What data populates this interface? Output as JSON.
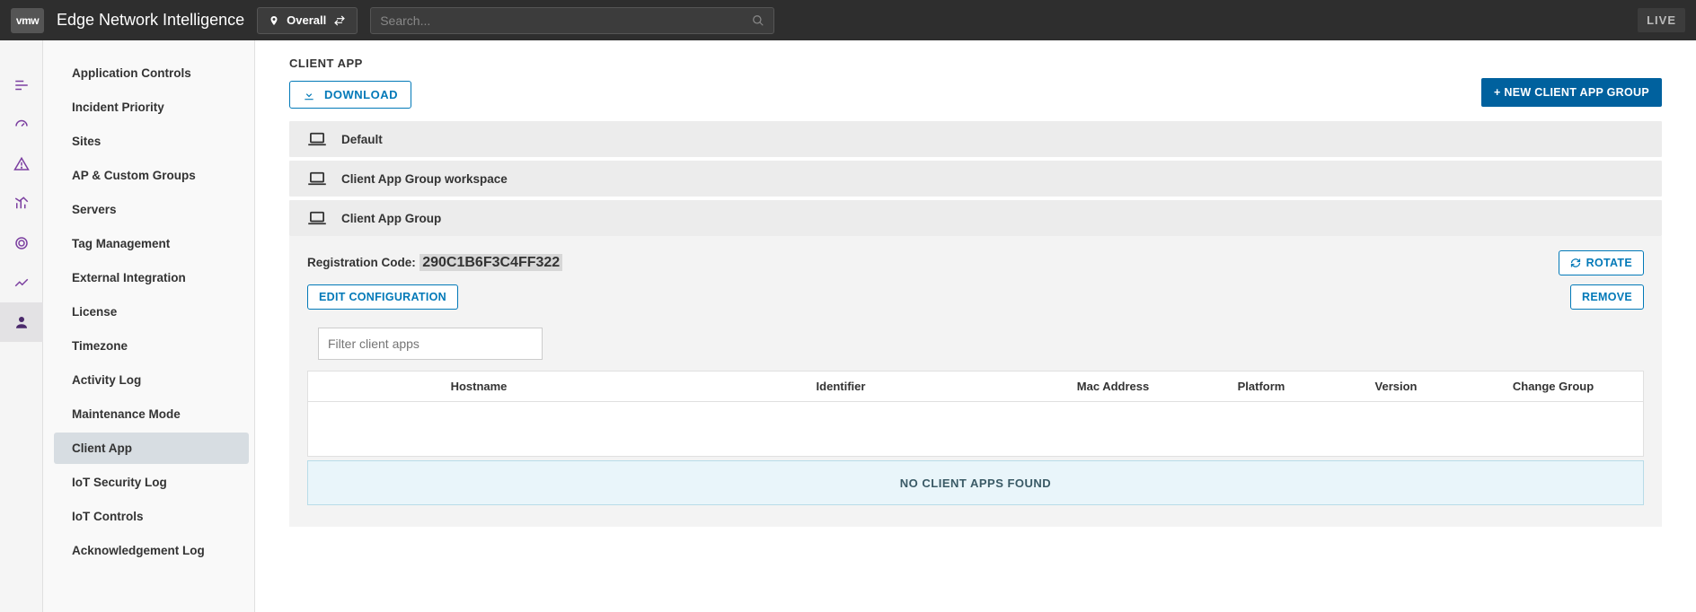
{
  "header": {
    "logo_text": "vmw",
    "app_title": "Edge Network Intelligence",
    "overall_label": "Overall",
    "search_placeholder": "Search...",
    "live_label": "LIVE"
  },
  "sidebar": {
    "items": [
      "Application Controls",
      "Incident Priority",
      "Sites",
      "AP & Custom Groups",
      "Servers",
      "Tag Management",
      "External Integration",
      "License",
      "Timezone",
      "Activity Log",
      "Maintenance Mode",
      "Client App",
      "IoT Security Log",
      "IoT Controls",
      "Acknowledgement Log"
    ],
    "selected_index": 11
  },
  "main": {
    "section_title": "CLIENT APP",
    "download_label": "DOWNLOAD",
    "new_group_label": "+ NEW CLIENT APP GROUP",
    "groups": [
      {
        "name": "Default"
      },
      {
        "name": "Client App Group workspace"
      },
      {
        "name": "Client App Group"
      }
    ],
    "expanded": {
      "reg_label": "Registration Code:",
      "reg_code": "290C1B6F3C4FF322",
      "rotate_label": "ROTATE",
      "edit_label": "EDIT CONFIGURATION",
      "remove_label": "REMOVE",
      "filter_placeholder": "Filter client apps",
      "columns": {
        "hostname": "Hostname",
        "identifier": "Identifier",
        "mac": "Mac Address",
        "platform": "Platform",
        "version": "Version",
        "change": "Change Group"
      },
      "empty_message": "NO CLIENT APPS FOUND"
    }
  }
}
